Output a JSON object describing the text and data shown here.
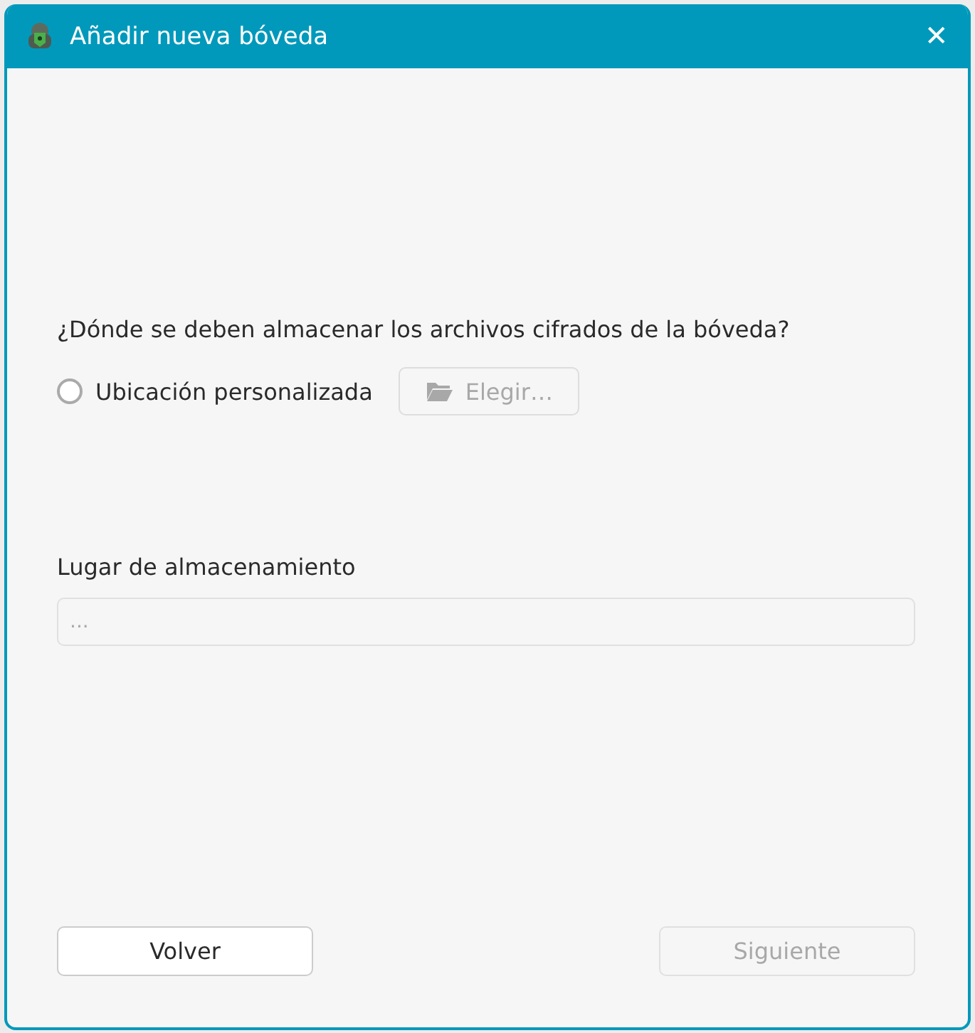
{
  "window": {
    "title": "Añadir nueva bóveda",
    "close": "✕"
  },
  "question": "¿Dónde se deben almacenar los archivos cifrados de la bóveda?",
  "custom_location": {
    "label": "Ubicación personalizada",
    "selected": false
  },
  "choose_button": {
    "label": "Elegir…",
    "disabled": true
  },
  "storage": {
    "label": "Lugar de almacenamiento",
    "placeholder": "..."
  },
  "buttons": [
    {
      "label": "Volver",
      "disabled": false
    },
    {
      "label": "Siguiente",
      "disabled": true
    }
  ]
}
